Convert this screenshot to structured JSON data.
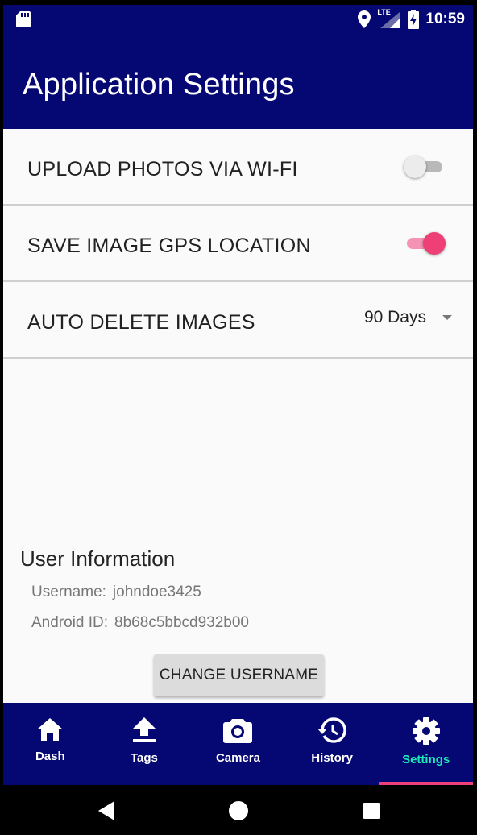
{
  "status_bar": {
    "time": "10:59",
    "network": "LTE"
  },
  "app_bar": {
    "title": "Application Settings"
  },
  "settings": {
    "upload_wifi": {
      "label": "UPLOAD PHOTOS VIA WI-FI",
      "enabled": false
    },
    "gps_location": {
      "label": "SAVE IMAGE GPS LOCATION",
      "enabled": true
    },
    "auto_delete": {
      "label": "AUTO DELETE IMAGES",
      "selected": "90 Days"
    }
  },
  "user_info": {
    "title": "User Information",
    "username_label": "Username:",
    "username": "johndoe3425",
    "android_id_label": "Android ID:",
    "android_id": "8b68c5bbcd932b00",
    "change_button": "CHANGE USERNAME"
  },
  "bottom_nav": {
    "items": [
      {
        "label": "Dash",
        "icon": "home-icon"
      },
      {
        "label": "Tags",
        "icon": "upload-icon"
      },
      {
        "label": "Camera",
        "icon": "camera-icon"
      },
      {
        "label": "History",
        "icon": "history-icon"
      },
      {
        "label": "Settings",
        "icon": "gear-icon"
      }
    ],
    "active": "Settings"
  },
  "colors": {
    "primary": "#050772",
    "accent": "#ee3f77",
    "active_label": "#1de9b6"
  }
}
